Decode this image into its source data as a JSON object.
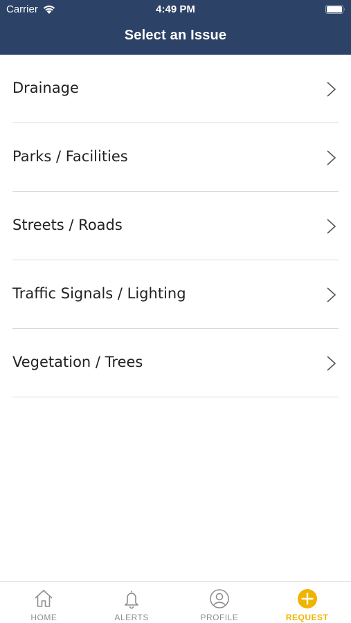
{
  "status_bar": {
    "carrier": "Carrier",
    "time": "4:49 PM"
  },
  "header": {
    "title": "Select an Issue",
    "background_color": "#2c4266"
  },
  "issues": [
    {
      "label": "Drainage"
    },
    {
      "label": "Parks / Facilities"
    },
    {
      "label": "Streets / Roads"
    },
    {
      "label": "Traffic Signals / Lighting"
    },
    {
      "label": "Vegetation / Trees"
    }
  ],
  "tab_bar": {
    "active_color": "#f0b400",
    "tabs": [
      {
        "label": "HOME",
        "icon": "home-icon"
      },
      {
        "label": "ALERTS",
        "icon": "bell-icon"
      },
      {
        "label": "PROFILE",
        "icon": "user-icon"
      },
      {
        "label": "REQUEST",
        "icon": "plus-circle-icon",
        "active": true
      }
    ]
  }
}
